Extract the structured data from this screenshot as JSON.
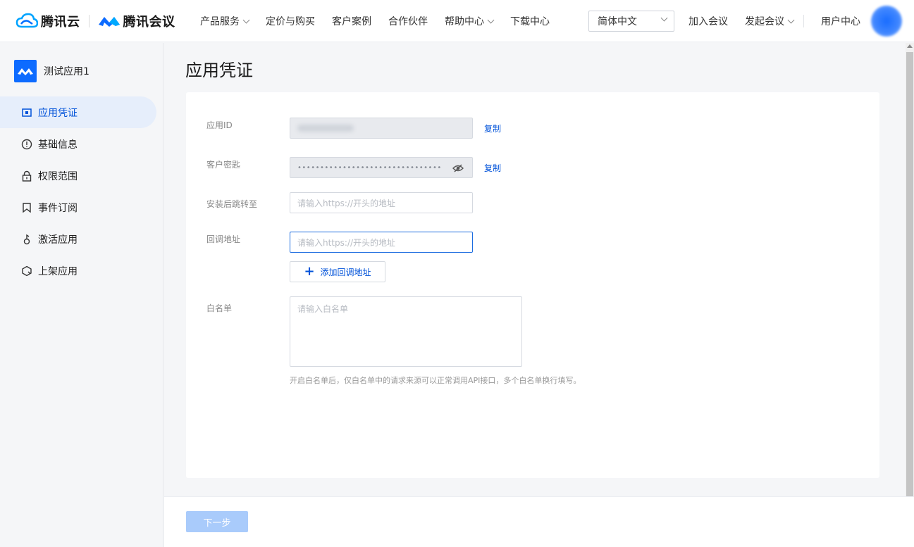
{
  "brand": {
    "cloud_name": "腾讯云",
    "meeting_name": "腾讯会议",
    "accent_color": "#0052d9"
  },
  "topnav": {
    "items": [
      {
        "label": "产品服务",
        "has_dropdown": true
      },
      {
        "label": "定价与购买",
        "has_dropdown": false
      },
      {
        "label": "客户案例",
        "has_dropdown": false
      },
      {
        "label": "合作伙伴",
        "has_dropdown": false
      },
      {
        "label": "帮助中心",
        "has_dropdown": true
      },
      {
        "label": "下载中心",
        "has_dropdown": false
      }
    ],
    "language": "简体中文",
    "join_meeting": "加入会议",
    "start_meeting": "发起会议",
    "user_center": "用户中心"
  },
  "sidebar": {
    "app_name": "测试应用1",
    "items": [
      {
        "label": "应用凭证",
        "icon": "credential-icon",
        "active": true
      },
      {
        "label": "基础信息",
        "icon": "info-icon",
        "active": false
      },
      {
        "label": "权限范围",
        "icon": "lock-icon",
        "active": false
      },
      {
        "label": "事件订阅",
        "icon": "bookmark-icon",
        "active": false
      },
      {
        "label": "激活应用",
        "icon": "activate-icon",
        "active": false
      },
      {
        "label": "上架应用",
        "icon": "publish-icon",
        "active": false
      }
    ]
  },
  "main": {
    "title": "应用凭证",
    "app_id_label": "应用ID",
    "secret_label": "客户密匙",
    "secret_value": "••••••••••••••••••••••••••••••••",
    "copy_label": "复制",
    "redirect_label": "安装后跳转至",
    "redirect_placeholder": "请输入https://开头的地址",
    "callback_label": "回调地址",
    "callback_placeholder": "请输入https://开头的地址",
    "add_callback": "添加回调地址",
    "whitelist_label": "白名单",
    "whitelist_placeholder": "请输入白名单",
    "whitelist_hint": "开启白名单后，仅白名单中的请求来源可以正常调用API接口，多个白名单换行填写。"
  },
  "footer": {
    "next_label": "下一步"
  }
}
